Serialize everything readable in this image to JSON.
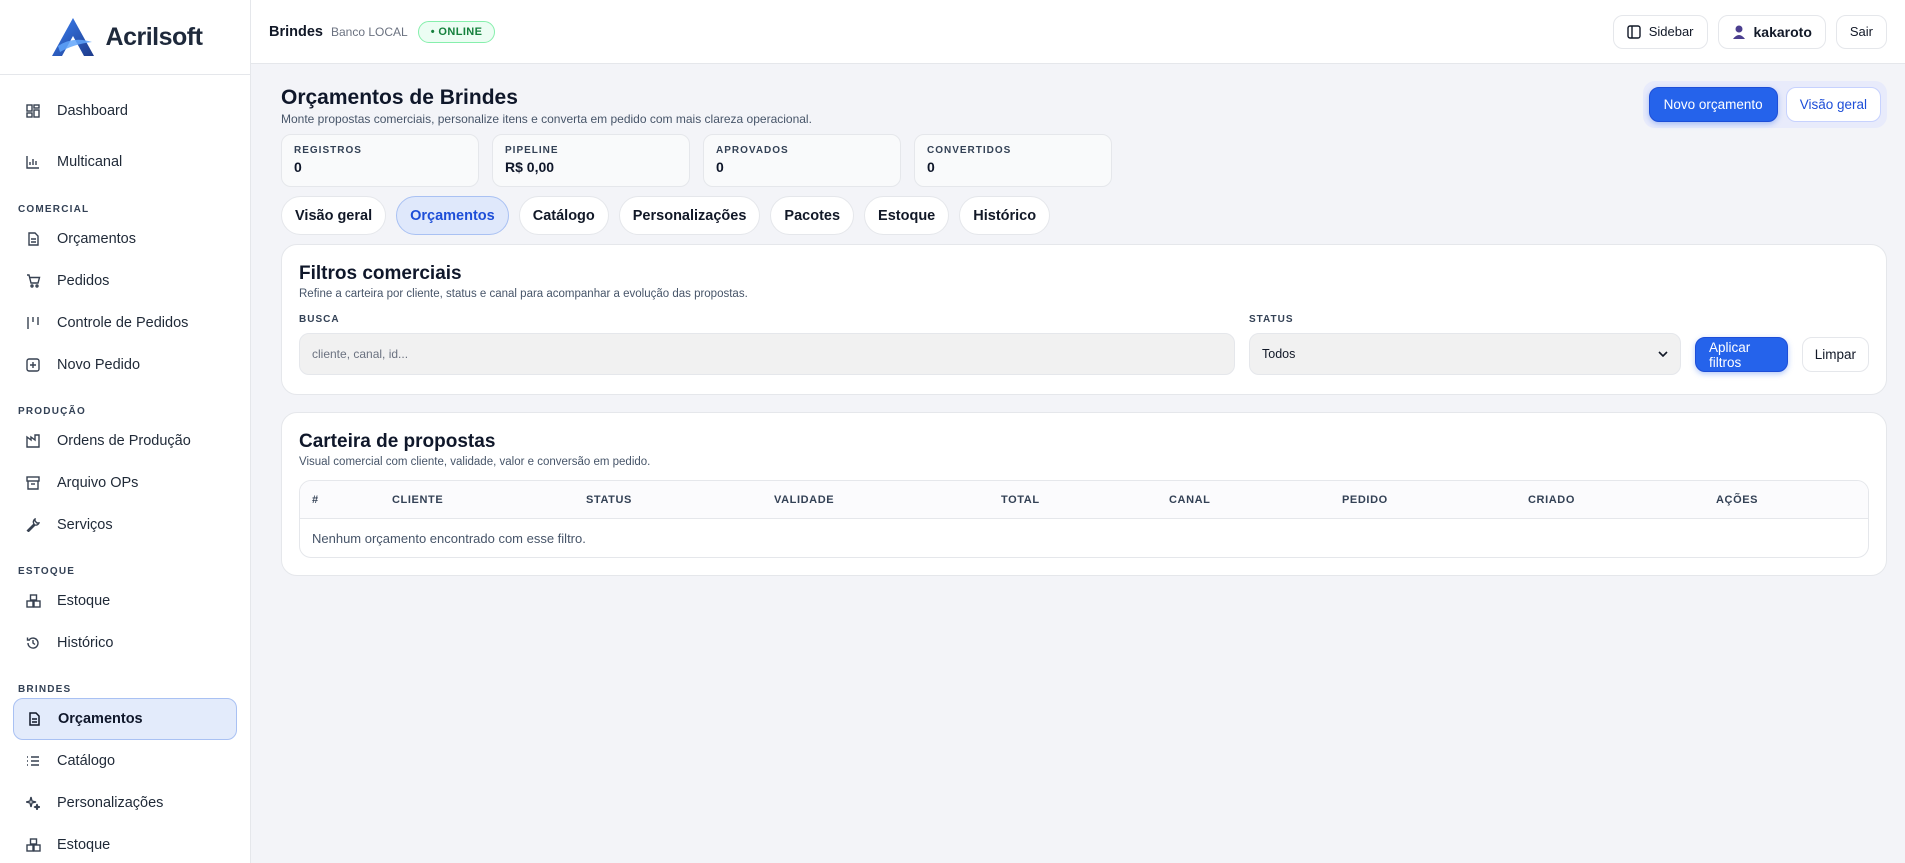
{
  "brand": {
    "name": "Acrilsoft"
  },
  "sidebar": {
    "top": [
      {
        "label": "Dashboard",
        "icon": "dashboard-icon"
      },
      {
        "label": "Multicanal",
        "icon": "chart-icon"
      }
    ],
    "sections": [
      {
        "title": "COMERCIAL",
        "items": [
          {
            "label": "Orçamentos",
            "icon": "document-icon"
          },
          {
            "label": "Pedidos",
            "icon": "cart-icon"
          },
          {
            "label": "Controle de Pedidos",
            "icon": "columns-icon"
          },
          {
            "label": "Novo Pedido",
            "icon": "plus-square-icon"
          }
        ]
      },
      {
        "title": "PRODUÇÃO",
        "items": [
          {
            "label": "Ordens de Produção",
            "icon": "factory-icon"
          },
          {
            "label": "Arquivo OPs",
            "icon": "archive-icon"
          },
          {
            "label": "Serviços",
            "icon": "wrench-icon"
          }
        ]
      },
      {
        "title": "ESTOQUE",
        "items": [
          {
            "label": "Estoque",
            "icon": "boxes-icon"
          },
          {
            "label": "Histórico",
            "icon": "history-icon"
          }
        ]
      },
      {
        "title": "BRINDES",
        "items": [
          {
            "label": "Orçamentos",
            "icon": "document-icon",
            "active": true
          },
          {
            "label": "Catálogo",
            "icon": "list-icon"
          },
          {
            "label": "Personalizações",
            "icon": "sparkles-icon"
          },
          {
            "label": "Estoque",
            "icon": "boxes-icon"
          }
        ]
      }
    ]
  },
  "topbar": {
    "title": "Brindes",
    "subtitle": "Banco LOCAL",
    "status": "• ONLINE",
    "sidebar_label": "Sidebar",
    "user": "kakaroto",
    "logout": "Sair"
  },
  "page": {
    "title": "Orçamentos de Brindes",
    "subtitle": "Monte propostas comerciais, personalize itens e converta em pedido com mais clareza operacional.",
    "new_button": "Novo orçamento",
    "overview_button": "Visão geral"
  },
  "stats": [
    {
      "label": "REGISTROS",
      "value": "0"
    },
    {
      "label": "PIPELINE",
      "value": "R$ 0,00"
    },
    {
      "label": "APROVADOS",
      "value": "0"
    },
    {
      "label": "CONVERTIDOS",
      "value": "0"
    }
  ],
  "tabs": [
    {
      "label": "Visão geral"
    },
    {
      "label": "Orçamentos",
      "active": true
    },
    {
      "label": "Catálogo"
    },
    {
      "label": "Personalizações"
    },
    {
      "label": "Pacotes"
    },
    {
      "label": "Estoque"
    },
    {
      "label": "Histórico"
    }
  ],
  "filters": {
    "title": "Filtros comerciais",
    "subtitle": "Refine a carteira por cliente, status e canal para acompanhar a evolução das propostas.",
    "search_label": "BUSCA",
    "search_placeholder": "cliente, canal, id...",
    "status_label": "STATUS",
    "status_value": "Todos",
    "apply": "Aplicar filtros",
    "clear": "Limpar"
  },
  "portfolio": {
    "title": "Carteira de propostas",
    "subtitle": "Visual comercial com cliente, validade, valor e conversão em pedido.",
    "columns": [
      "#",
      "CLIENTE",
      "STATUS",
      "VALIDADE",
      "TOTAL",
      "CANAL",
      "PEDIDO",
      "CRIADO",
      "AÇÕES"
    ],
    "empty": "Nenhum orçamento encontrado com esse filtro."
  },
  "colors": {
    "primary": "#2563eb",
    "online": "#15803d"
  }
}
